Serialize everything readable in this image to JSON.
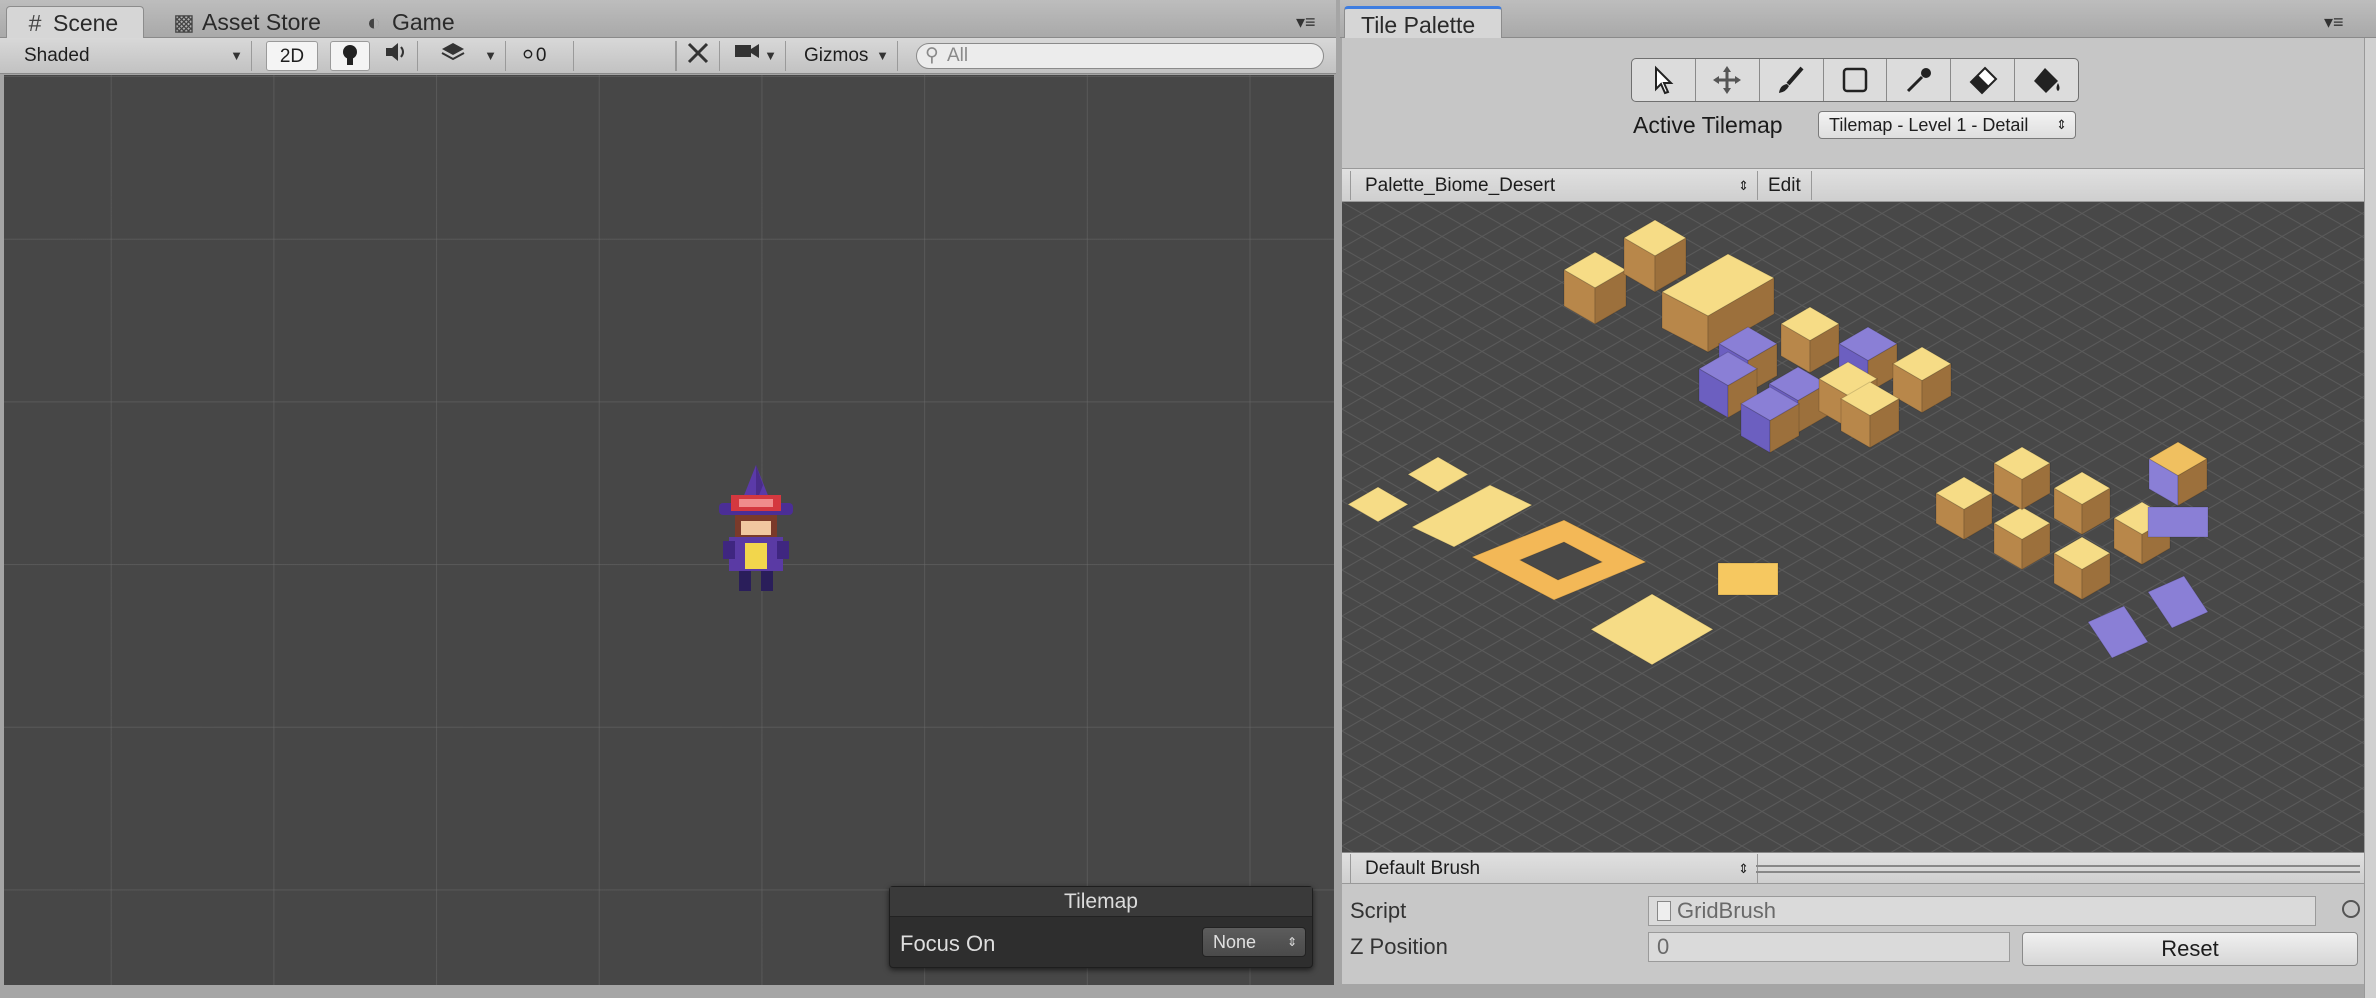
{
  "scene_panel": {
    "tabs": [
      {
        "label": "Scene",
        "icon": "grid-icon",
        "active": true
      },
      {
        "label": "Asset Store",
        "icon": "store-icon",
        "active": false
      },
      {
        "label": "Game",
        "icon": "pacman-icon",
        "active": false
      }
    ],
    "toolbar": {
      "shading_mode": "Shaded",
      "mode_2d": "2D",
      "hidden_count": "0",
      "gizmos_label": "Gizmos",
      "search_placeholder": "All"
    },
    "tilemap_overlay": {
      "title": "Tilemap",
      "focus_label": "Focus On",
      "focus_value": "None"
    }
  },
  "palette_panel": {
    "tab_label": "Tile Palette",
    "tools": [
      "select-tool-icon",
      "move-tool-icon",
      "paint-tool-icon",
      "box-fill-tool-icon",
      "picker-tool-icon",
      "eraser-tool-icon",
      "fill-tool-icon"
    ],
    "active_tilemap_label": "Active Tilemap",
    "active_tilemap_value": "Tilemap - Level 1 - Detail",
    "palette_name": "Palette_Biome_Desert",
    "edit_label": "Edit",
    "brush_name": "Default Brush",
    "inspector": {
      "script_label": "Script",
      "script_value": "GridBrush",
      "zpos_label": "Z Position",
      "zpos_value": "0",
      "reset_label": "Reset"
    }
  },
  "colors": {
    "sand_top": "#f6dc86",
    "sand_side": "#b8874a",
    "purple_rock": "#8a7fd6",
    "viewport_bg": "#474747"
  }
}
